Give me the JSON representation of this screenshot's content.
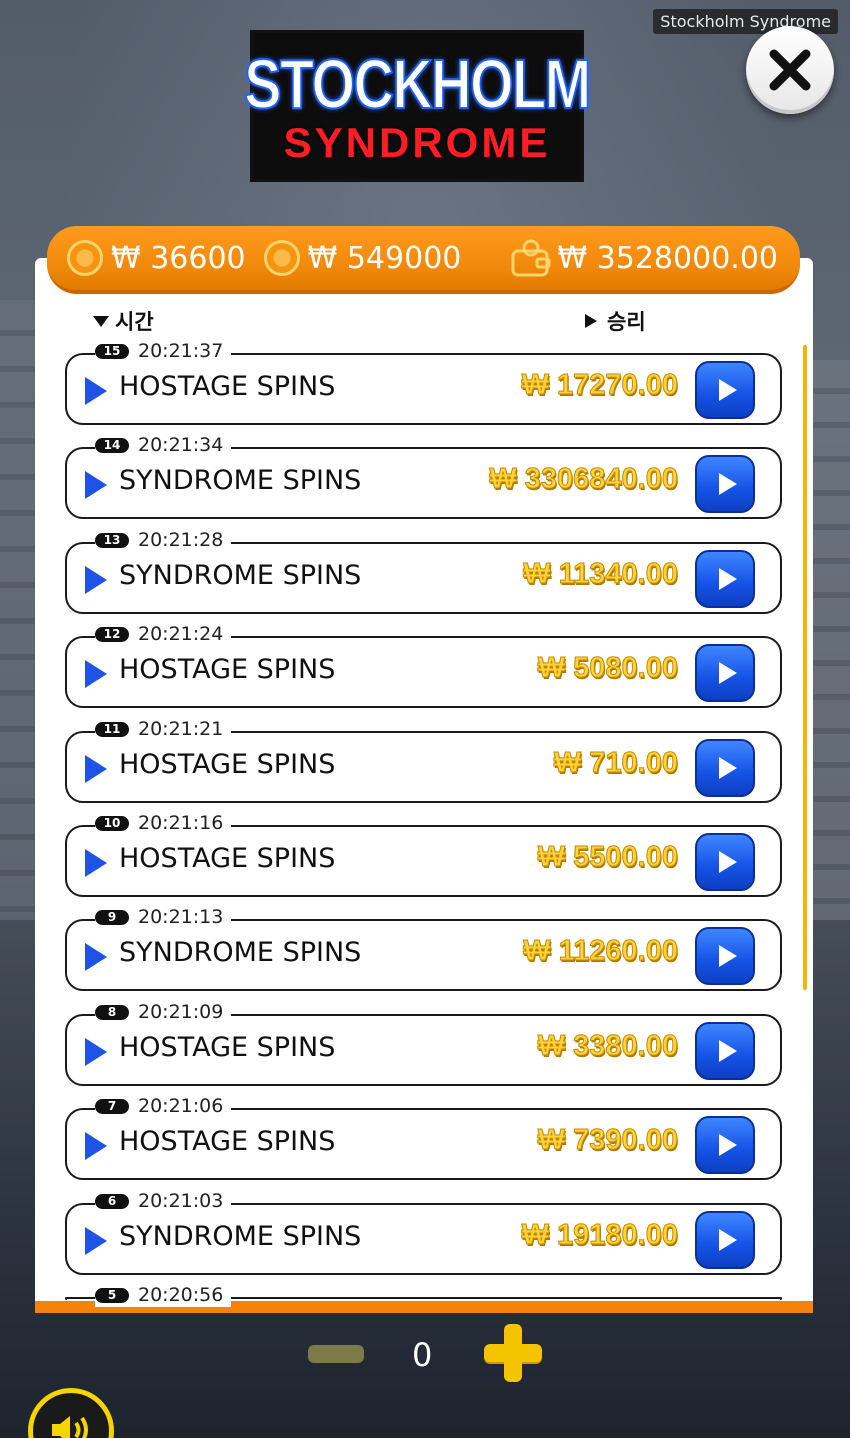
{
  "window": {
    "title": "Stockholm Syndrome"
  },
  "logo": {
    "top": "STOCKHOLM",
    "bottom": "SYNDROME"
  },
  "balances": {
    "bet": "₩ 36600",
    "win": "₩ 549000",
    "wallet": "₩ 3528000.00"
  },
  "columns": {
    "time": "시간",
    "win": "승리"
  },
  "history": [
    {
      "num": "15",
      "time": "20:21:37",
      "name": "HOSTAGE SPINS",
      "amount": "₩ 17270.00"
    },
    {
      "num": "14",
      "time": "20:21:34",
      "name": "SYNDROME SPINS",
      "amount": "₩ 3306840.00"
    },
    {
      "num": "13",
      "time": "20:21:28",
      "name": "SYNDROME SPINS",
      "amount": "₩ 11340.00"
    },
    {
      "num": "12",
      "time": "20:21:24",
      "name": "HOSTAGE SPINS",
      "amount": "₩ 5080.00"
    },
    {
      "num": "11",
      "time": "20:21:21",
      "name": "HOSTAGE SPINS",
      "amount": "₩ 710.00"
    },
    {
      "num": "10",
      "time": "20:21:16",
      "name": "HOSTAGE SPINS",
      "amount": "₩ 5500.00"
    },
    {
      "num": "9",
      "time": "20:21:13",
      "name": "SYNDROME SPINS",
      "amount": "₩ 11260.00"
    },
    {
      "num": "8",
      "time": "20:21:09",
      "name": "HOSTAGE SPINS",
      "amount": "₩ 3380.00"
    },
    {
      "num": "7",
      "time": "20:21:06",
      "name": "HOSTAGE SPINS",
      "amount": "₩ 7390.00"
    },
    {
      "num": "6",
      "time": "20:21:03",
      "name": "SYNDROME SPINS",
      "amount": "₩ 19180.00"
    },
    {
      "num": "5",
      "time": "20:20:56",
      "name": "",
      "amount": ""
    }
  ],
  "controls": {
    "counter": "0"
  },
  "icons": {
    "close": "close-icon",
    "coin": "coin-icon",
    "wallet": "wallet-icon",
    "play": "play-icon",
    "sound": "speaker-icon"
  },
  "colors": {
    "accent": "#f5820b",
    "amount": "#ffd23a",
    "button": "#1552e6"
  }
}
